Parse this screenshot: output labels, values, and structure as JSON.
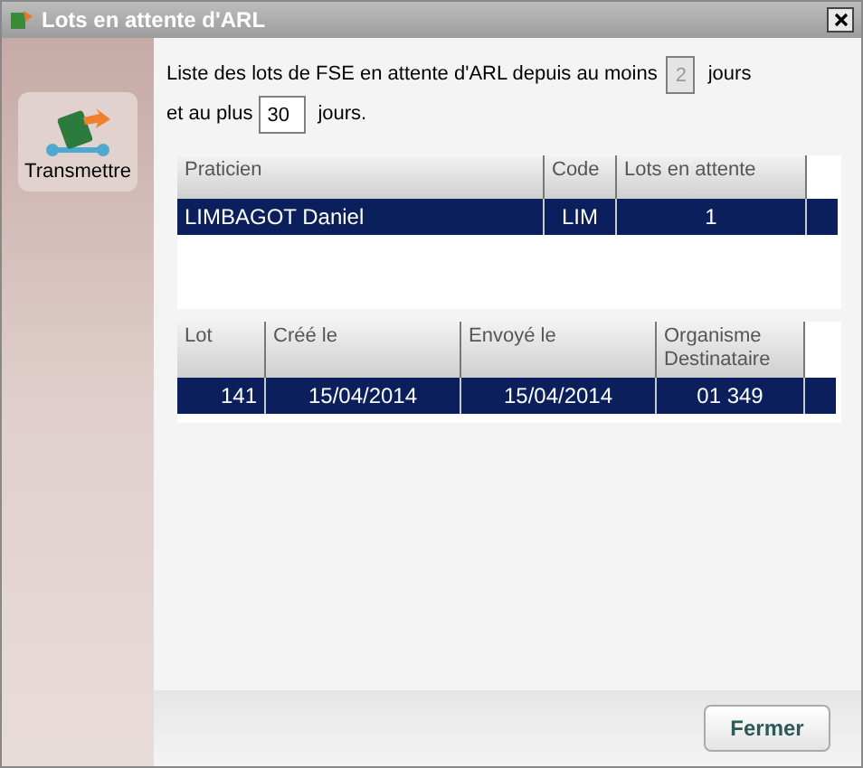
{
  "window": {
    "title": "Lots en attente d'ARL"
  },
  "sidebar": {
    "items": [
      {
        "label": "Transmettre"
      }
    ]
  },
  "filter": {
    "text_before": "Liste des lots de FSE en attente d'ARL depuis au moins",
    "min_days": {
      "value": "2",
      "disabled": true
    },
    "text_after_min": "jours",
    "text_before_max": "et au plus",
    "max_days": {
      "value": "30",
      "disabled": false
    },
    "text_after_max": "jours."
  },
  "praticiens": {
    "columns": [
      "Praticien",
      "Code",
      "Lots en attente"
    ],
    "rows": [
      {
        "cells": [
          "LIMBAGOT Daniel",
          "LIM",
          "1"
        ],
        "selected": true
      }
    ]
  },
  "lots": {
    "columns": [
      "Lot",
      "Créé le",
      "Envoyé le",
      "Organisme Destinataire"
    ],
    "rows": [
      {
        "cells": [
          "141",
          "15/04/2014",
          "15/04/2014",
          "01 349"
        ],
        "selected": true
      }
    ]
  },
  "buttons": [
    "Fermer"
  ]
}
